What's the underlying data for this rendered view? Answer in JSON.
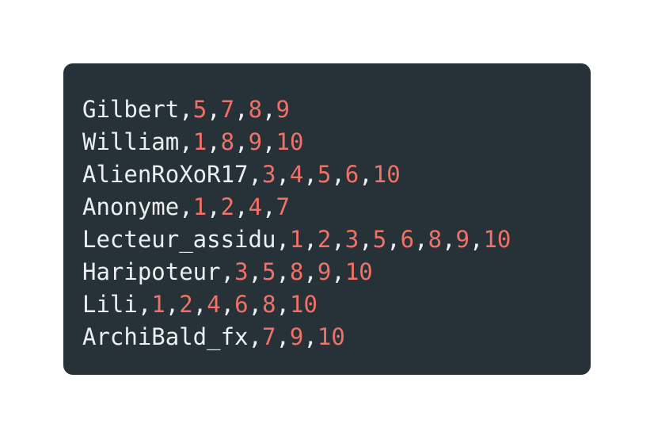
{
  "code_block": {
    "lines": [
      {
        "name": "Gilbert",
        "values": [
          "5",
          "7",
          "8",
          "9"
        ]
      },
      {
        "name": "William",
        "values": [
          "1",
          "8",
          "9",
          "10"
        ]
      },
      {
        "name": "AlienRoXoR17",
        "values": [
          "3",
          "4",
          "5",
          "6",
          "10"
        ]
      },
      {
        "name": "Anonyme",
        "values": [
          "1",
          "2",
          "4",
          "7"
        ]
      },
      {
        "name": "Lecteur_assidu",
        "values": [
          "1",
          "2",
          "3",
          "5",
          "6",
          "8",
          "9",
          "10"
        ]
      },
      {
        "name": "Haripoteur",
        "values": [
          "3",
          "5",
          "8",
          "9",
          "10"
        ]
      },
      {
        "name": "Lili",
        "values": [
          "1",
          "2",
          "4",
          "6",
          "8",
          "10"
        ]
      },
      {
        "name": "ArchiBald_fx",
        "values": [
          "7",
          "9",
          "10"
        ]
      }
    ],
    "separator": ",",
    "colors": {
      "background": "#263238",
      "name": "#eceff1",
      "number": "#f07167"
    }
  }
}
